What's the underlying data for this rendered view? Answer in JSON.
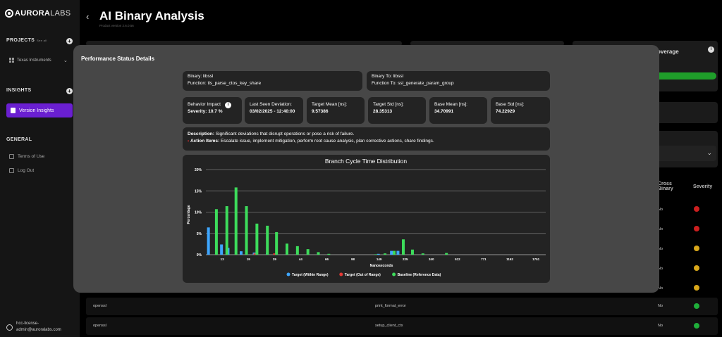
{
  "app": {
    "logo_bold": "AURORA",
    "logo_thin": "LABS",
    "title": "AI Binary Analysis",
    "subtitle": "Product version 2.6.0.56"
  },
  "sidebar": {
    "projects_label": "PROJECTS",
    "see_all": "See all",
    "project_name": "Texas Instruments",
    "insights_label": "INSIGHTS",
    "active_item": "Version Insights",
    "general_label": "GENERAL",
    "terms": "Terms of Use",
    "logout": "Log Out",
    "user_line1": "hcc-license-",
    "user_line2": "admin@auroralabs.com"
  },
  "background": {
    "coverage_label": "overage",
    "table_headers": {
      "cross_binary_1": "Cross",
      "cross_binary_2": "Binary",
      "severity": "Severity"
    },
    "side_rows": [
      {
        "cross": "No",
        "severity_color": "#cc1f1f"
      },
      {
        "cross": "No",
        "severity_color": "#cc1f1f"
      },
      {
        "cross": "No",
        "severity_color": "#d9a71a"
      },
      {
        "cross": "No",
        "severity_color": "#d9a71a"
      },
      {
        "cross": "No",
        "severity_color": "#d9a71a"
      }
    ],
    "rows": [
      {
        "binary": "openssl",
        "function": "print_format_error",
        "cross": "No",
        "severity_color": "#1fae3a"
      },
      {
        "binary": "openssl",
        "function": "setup_client_ctx",
        "cross": "No",
        "severity_color": "#1fae3a"
      }
    ]
  },
  "modal": {
    "title": "Performance Status Details",
    "binary": "Binary: libssl",
    "function": "Function: tls_parse_ctos_key_share",
    "binary_to": "Binary To: libssl",
    "function_to": "Function To: ssl_generate_param_group",
    "behavior_label": "Behavior Impact",
    "behavior_value": "Severity: 10.7 %",
    "last_seen_label": "Last Seen Deviation:",
    "last_seen_value": "03/02/2025 - 12:40:00",
    "target_mean_label": "Target Mean [ns]:",
    "target_mean_value": "9.57386",
    "target_std_label": "Target Std [ns]:",
    "target_std_value": "28.35313",
    "base_mean_label": "Base Mean [ns]:",
    "base_mean_value": "34.70991",
    "base_std_label": "Base Std [ns]:",
    "base_std_value": "74.22929",
    "description_label": "Description:",
    "description_text": "Significant deviations that disrupt operations or pose a risk of failure.",
    "action_label": "Action Items:",
    "action_text": "Escalate issue, implement mitigation, perform root cause analysis, plan corrective actions, share findings."
  },
  "chart_data": {
    "type": "bar",
    "title": "Branch Cycle Time Distribution",
    "xlabel": "Nanoseconds",
    "ylabel": "Percentage",
    "ylim": [
      0,
      20
    ],
    "y_ticks": [
      "0%",
      "5%",
      "10%",
      "15%",
      "20%"
    ],
    "x_tick_labels": [
      "13",
      "19",
      "29",
      "44",
      "66",
      "98",
      "149",
      "225",
      "340",
      "512",
      "771",
      "1162",
      "1751"
    ],
    "x_tick_bins": [
      2,
      6,
      10,
      14,
      18,
      22,
      26,
      30,
      34,
      38,
      42,
      46,
      50
    ],
    "bins": 52,
    "grid": true,
    "legend_position": "bottom",
    "series": [
      {
        "name": "Target (Within Range)",
        "color": "#3ea6ff",
        "points": [
          [
            0,
            6.4
          ],
          [
            2,
            2.4
          ],
          [
            3,
            1.6
          ],
          [
            5,
            0.8
          ],
          [
            7,
            0.5
          ],
          [
            9,
            0.4
          ],
          [
            26,
            0.2
          ],
          [
            28,
            0.9
          ],
          [
            29,
            0.9
          ]
        ]
      },
      {
        "name": "Target (Out of Range)",
        "color": "#e53935",
        "points": [
          [
            7,
            0.3
          ],
          [
            10,
            0.3
          ]
        ]
      },
      {
        "name": "Baseline (Reference Data)",
        "color": "#3ddc5b",
        "points": [
          [
            1,
            10.7
          ],
          [
            2.6,
            11.4
          ],
          [
            4,
            15.8
          ],
          [
            5.6,
            11.4
          ],
          [
            7.2,
            7.3
          ],
          [
            8.8,
            6.8
          ],
          [
            10.2,
            5.3
          ],
          [
            11.8,
            2.6
          ],
          [
            13.4,
            2.0
          ],
          [
            15,
            1.3
          ],
          [
            16.6,
            0.6
          ],
          [
            18.2,
            0.2
          ],
          [
            25.4,
            0.1
          ],
          [
            26.8,
            0.3
          ],
          [
            28.2,
            0.9
          ],
          [
            29.6,
            3.6
          ],
          [
            31,
            1.2
          ],
          [
            32.6,
            0.3
          ],
          [
            36.2,
            0.4
          ]
        ]
      }
    ]
  }
}
